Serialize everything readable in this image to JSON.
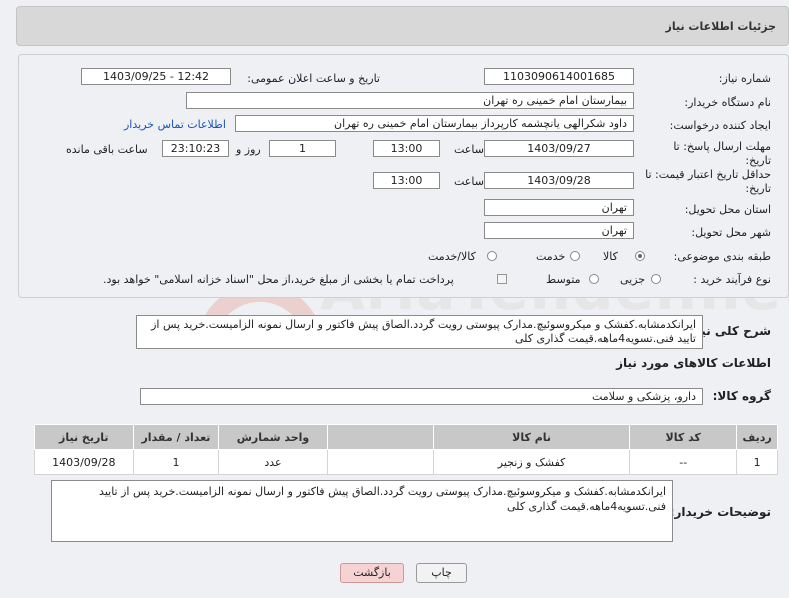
{
  "header": {
    "title": "جزئیات اطلاعات نیاز"
  },
  "fields": {
    "need_number_label": "شماره نیاز:",
    "need_number": "1103090614001685",
    "announce_label": "تاریخ و ساعت اعلان عمومی:",
    "announce_value": "1403/09/25 - 12:42",
    "buyer_org_label": "نام دستگاه خریدار:",
    "buyer_org": "بیمارستان امام خمینی ره  تهران",
    "creator_label": "ایجاد کننده درخواست:",
    "creator": "داود شکرالهی یانچشمه کارپرداز بیمارستان امام خمینی ره  تهران",
    "contact_link": "اطلاعات تماس خریدار",
    "deadline_label_1": "مهلت ارسال پاسخ: تا",
    "deadline_label_2": "تاریخ:",
    "deadline_date": "1403/09/27",
    "time_label": "ساعت",
    "deadline_time": "13:00",
    "days_value": "1",
    "days_label": "روز و",
    "remaining_time": "23:10:23",
    "remaining_label": "ساعت باقی مانده",
    "validity_label_1": "حداقل تاریخ اعتبار قیمت: تا",
    "validity_label_2": "تاریخ:",
    "validity_date": "1403/09/28",
    "validity_time": "13:00",
    "province_label": "استان محل تحویل:",
    "province": "تهران",
    "city_label": "شهر محل تحویل:",
    "city": "تهران",
    "category_label": "طبقه بندی موضوعی:",
    "category_options": [
      "کالا",
      "خدمت",
      "کالا/خدمت"
    ],
    "category_selected": "کالا",
    "process_label": "نوع فرآیند خرید :",
    "process_options": [
      "جزیی",
      "متوسط"
    ],
    "payment_note": "پرداخت تمام یا بخشی از مبلغ خرید،از محل \"اسناد خزانه اسلامی\" خواهد بود."
  },
  "description": {
    "label": "شرح کلی نیاز:",
    "text": "ایرانکدمشابه.کفشک و میکروسوئیچ.مدارک پیوستی رویت گردد.الصاق پیش فاکتور و ارسال نمونه الزامیست.خرید پس از تایید فنی.تسویه4ماهه.قیمت گذاری کلی"
  },
  "goods_info": {
    "section_title": "اطلاعات کالاهای مورد نیاز",
    "group_label": "گروه کالا:",
    "group_value": "دارو، پزشکی و سلامت"
  },
  "table": {
    "headers": [
      "ردیف",
      "کد کالا",
      "نام کالا",
      "واحد شمارش",
      "تعداد / مقدار",
      "تاریخ نیاز"
    ],
    "rows": [
      [
        "1",
        "--",
        "کفشک و زنجیر",
        "عدد",
        "1",
        "1403/09/28"
      ]
    ]
  },
  "buyer_notes": {
    "label": "توضیحات خریدار:",
    "text": "ایرانکدمشابه.کفشک و میکروسوئیچ.مدارک پیوستی رویت گردد.الصاق پیش فاکتور و ارسال نمونه الزامیست.خرید پس از تایید فنی.تسویه4ماهه.قیمت گذاری کلی"
  },
  "buttons": {
    "print": "چاپ",
    "back": "بازگشت"
  },
  "watermark": "AriaTender.net"
}
